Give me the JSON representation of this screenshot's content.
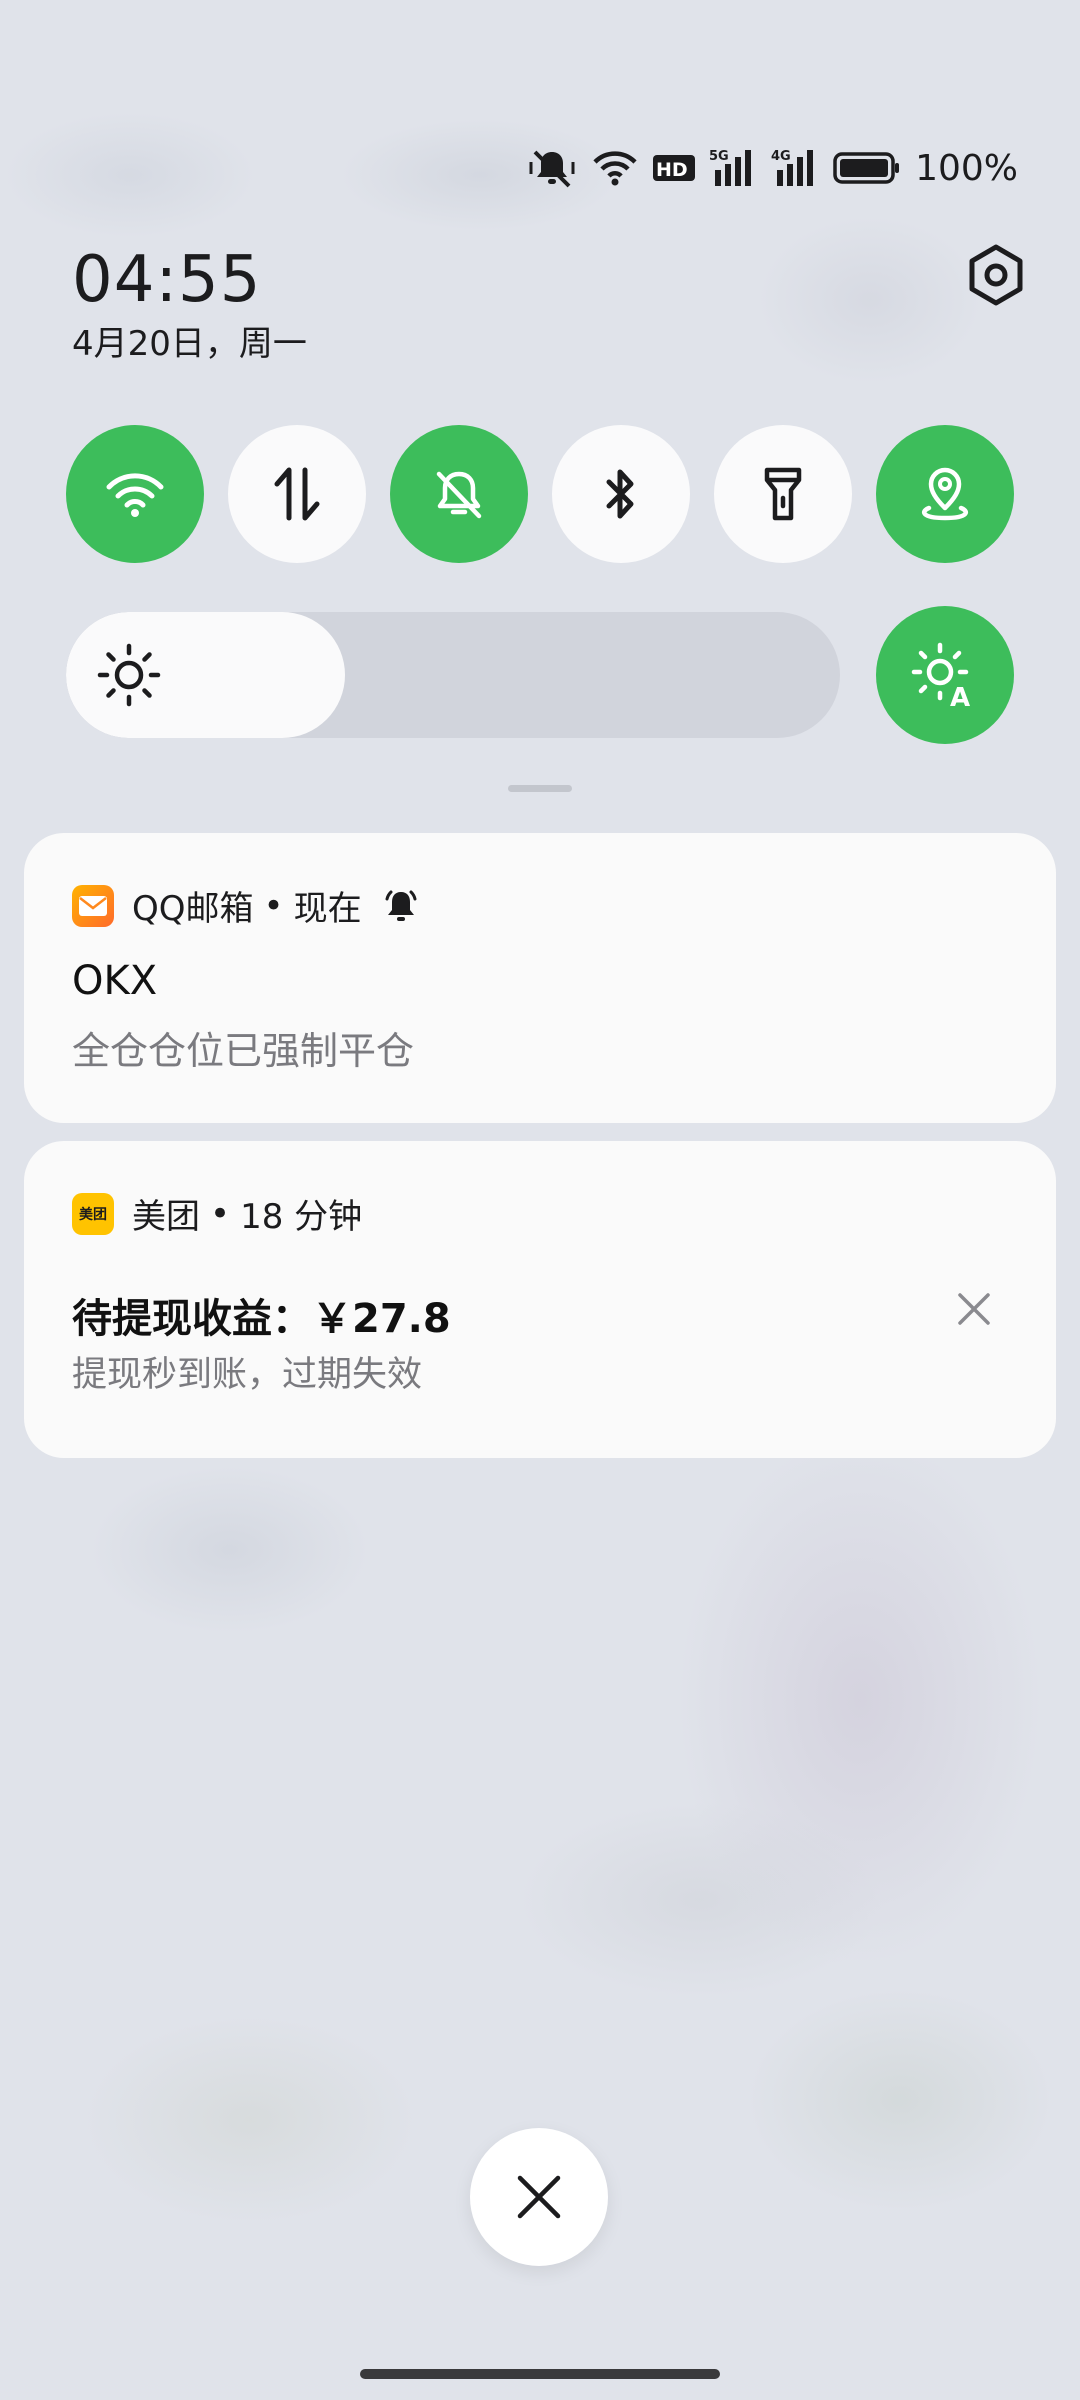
{
  "status_bar": {
    "icons": [
      "mute-icon",
      "wifi-icon",
      "hd-icon",
      "signal-5g-icon",
      "signal-4g-icon",
      "battery-icon"
    ],
    "battery_text": "100%"
  },
  "header": {
    "time": "04:55",
    "date": "4月20日，周一"
  },
  "quick_tiles": [
    {
      "name": "wifi",
      "icon": "wifi-icon",
      "on": true
    },
    {
      "name": "mobile-data",
      "icon": "data-arrows-icon",
      "on": false
    },
    {
      "name": "silent",
      "icon": "bell-off-icon",
      "on": true
    },
    {
      "name": "bluetooth",
      "icon": "bluetooth-icon",
      "on": false
    },
    {
      "name": "flashlight",
      "icon": "flashlight-icon",
      "on": false
    },
    {
      "name": "location",
      "icon": "location-icon",
      "on": true
    }
  ],
  "brightness": {
    "level": 0.36,
    "auto": true
  },
  "notifications": [
    {
      "app": "QQ邮箱",
      "time": "现在",
      "title": "OKX",
      "body": "全仓仓位已强制平仓",
      "icon_color": "#f6a623"
    },
    {
      "app": "美团",
      "time": "18 分钟",
      "title": "待提现收益：￥27.8",
      "body": "提现秒到账，过期失效",
      "icon_label": "美团",
      "icon_color": "#ffc300"
    }
  ],
  "colors": {
    "accent_green": "#3dbd5b",
    "tile_off": "#fafafb",
    "background": "#e0e3ea"
  }
}
